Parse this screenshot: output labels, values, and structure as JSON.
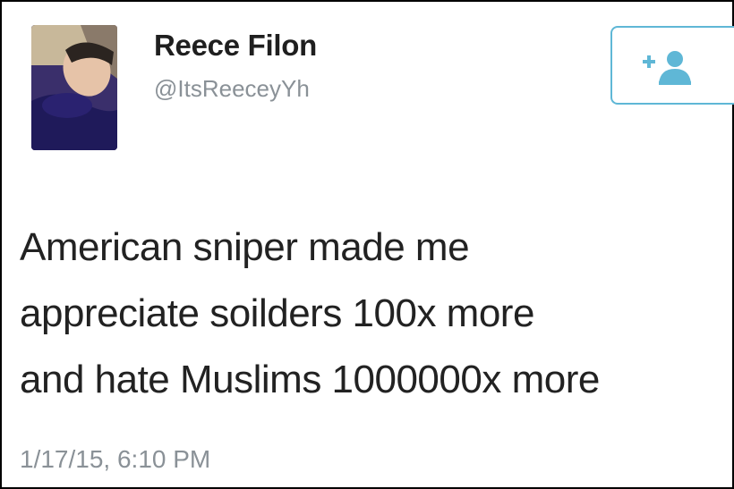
{
  "tweet": {
    "author": {
      "display_name": "Reece Filon",
      "handle": "@ItsReeceyYh"
    },
    "follow_button": {
      "icon": "add-user-icon",
      "accent_color": "#5fb7d6"
    },
    "text": "American sniper made me\nappreciate soilders 100x more\nand hate Muslims 1000000x more",
    "timestamp": "1/17/15, 6:10 PM"
  }
}
